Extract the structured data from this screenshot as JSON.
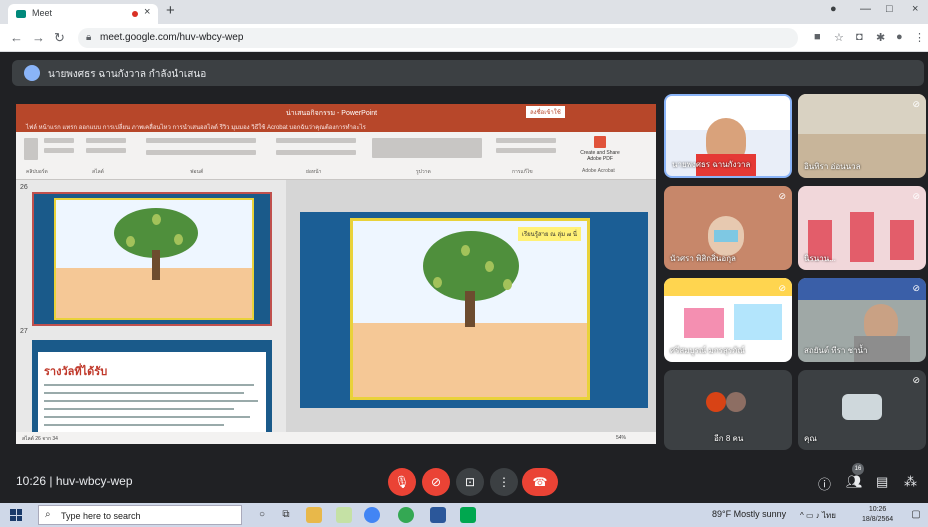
{
  "browser": {
    "tab_title": "Meet",
    "tab_close": "×",
    "new_tab": "+",
    "url": "meet.google.com/huv-wbcy-wep",
    "window_controls": [
      "—",
      "□",
      "×"
    ]
  },
  "presenter": {
    "label": "นายพงศธร ฉานกังวาล กำลังนำเสนอ"
  },
  "powerpoint": {
    "window_title": "น่าเสนอกิจกรรม - PowerPoint",
    "sign_in": "ลงชื่อเข้าใช้",
    "ribbon_tabs": "ไฟล์   หน้าแรก   แทรก   ออกแบบ   การเปลี่ยน   ภาพเคลื่อนไหว   การนำเสนอสไลด์   รีวิว   มุมมอง   วิธีใช้   Acrobat   บอกฉันว่าคุณต้องการทำอะไร",
    "create_pdf": "Create and Share Adobe PDF",
    "group_labels": [
      "คลิปบอร์ด",
      "สไลด์",
      "ฟอนต์",
      "ย่อหน้า",
      "รูปวาด",
      "การแก้ไข",
      "Adobe Acrobat"
    ],
    "slide_numbers": [
      "26",
      "27"
    ],
    "thumb27_heading": "รางวัลที่ได้รับ",
    "main_badge": "เรียนรู้สาย ณ ลุ่ม ๗ นี่",
    "status_left": "สไลด์ 26 จาก 34",
    "status_zoom": "54%"
  },
  "participants": [
    {
      "name": "นายพงศธร ฉานกังวาล",
      "muted": true
    },
    {
      "name": "อินทิรา อ่อนนวล",
      "muted": true
    },
    {
      "name": "นัวศรา พิสิกสิ่นอกุล",
      "muted": true
    },
    {
      "name": "นิรนาน...",
      "muted": true
    },
    {
      "name": "ศรีสมบูรณ์ มกรสุรภัณ์",
      "muted": true
    },
    {
      "name": "สถยันต์ ทีรา ชาน้ำ",
      "muted": true
    },
    {
      "name": "อีก 8 คน",
      "muted": false
    },
    {
      "name": "คุณ",
      "muted": true
    }
  ],
  "meeting": {
    "time": "10:26",
    "code": "huv-wbcy-wep",
    "participant_count": "16"
  },
  "taskbar": {
    "search_placeholder": "Type here to search",
    "weather": "89°F  Mostly sunny",
    "lang": "ไทย",
    "clock_time": "10:26",
    "clock_date": "18/8/2564"
  }
}
